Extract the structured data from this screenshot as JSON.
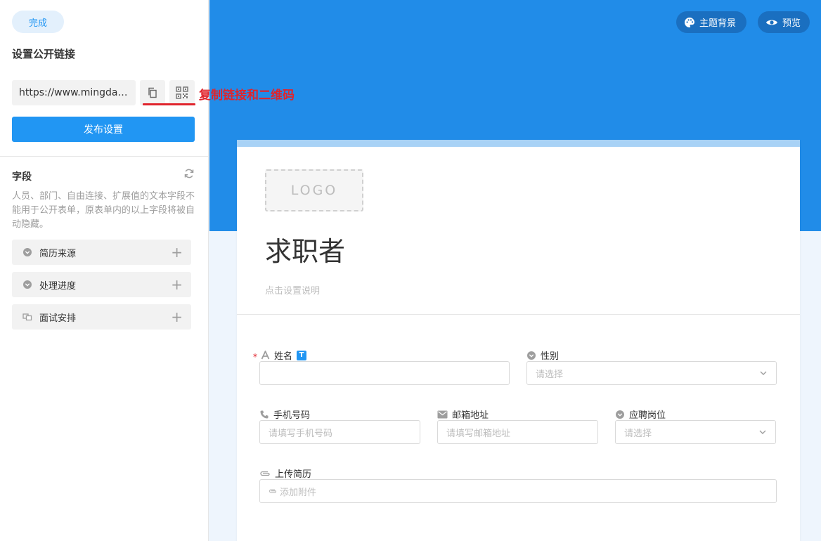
{
  "sidebar": {
    "done_label": "完成",
    "title": "设置公开链接",
    "url": "https://www.mingdao.c...",
    "annotation": "复制链接和二维码",
    "publish_label": "发布设置",
    "fields_title": "字段",
    "fields_desc": "人员、部门、自由连接、扩展值的文本字段不能用于公开表单，原表单内的以上字段将被自动隐藏。",
    "items": [
      {
        "label": "简历来源",
        "icon": "dropdown-icon"
      },
      {
        "label": "处理进度",
        "icon": "dropdown-icon"
      },
      {
        "label": "面试安排",
        "icon": "relation-icon"
      }
    ],
    "plus": "+"
  },
  "header": {
    "theme_label": "主题背景",
    "preview_label": "预览"
  },
  "form": {
    "logo": "LOGO",
    "title": "求职者",
    "desc": "点击设置说明",
    "fields": {
      "name": {
        "label": "姓名",
        "badge": "T",
        "required": "*"
      },
      "gender": {
        "label": "性别",
        "placeholder": "请选择"
      },
      "phone": {
        "label": "手机号码",
        "placeholder": "请填写手机号码"
      },
      "email": {
        "label": "邮箱地址",
        "placeholder": "请填写邮箱地址"
      },
      "position": {
        "label": "应聘岗位",
        "placeholder": "请选择"
      },
      "resume": {
        "label": "上传简历",
        "placeholder": "添加附件"
      }
    }
  },
  "colors": {
    "primary": "#2196f3",
    "banner": "#218ce8",
    "annotation": "#e0242c"
  }
}
